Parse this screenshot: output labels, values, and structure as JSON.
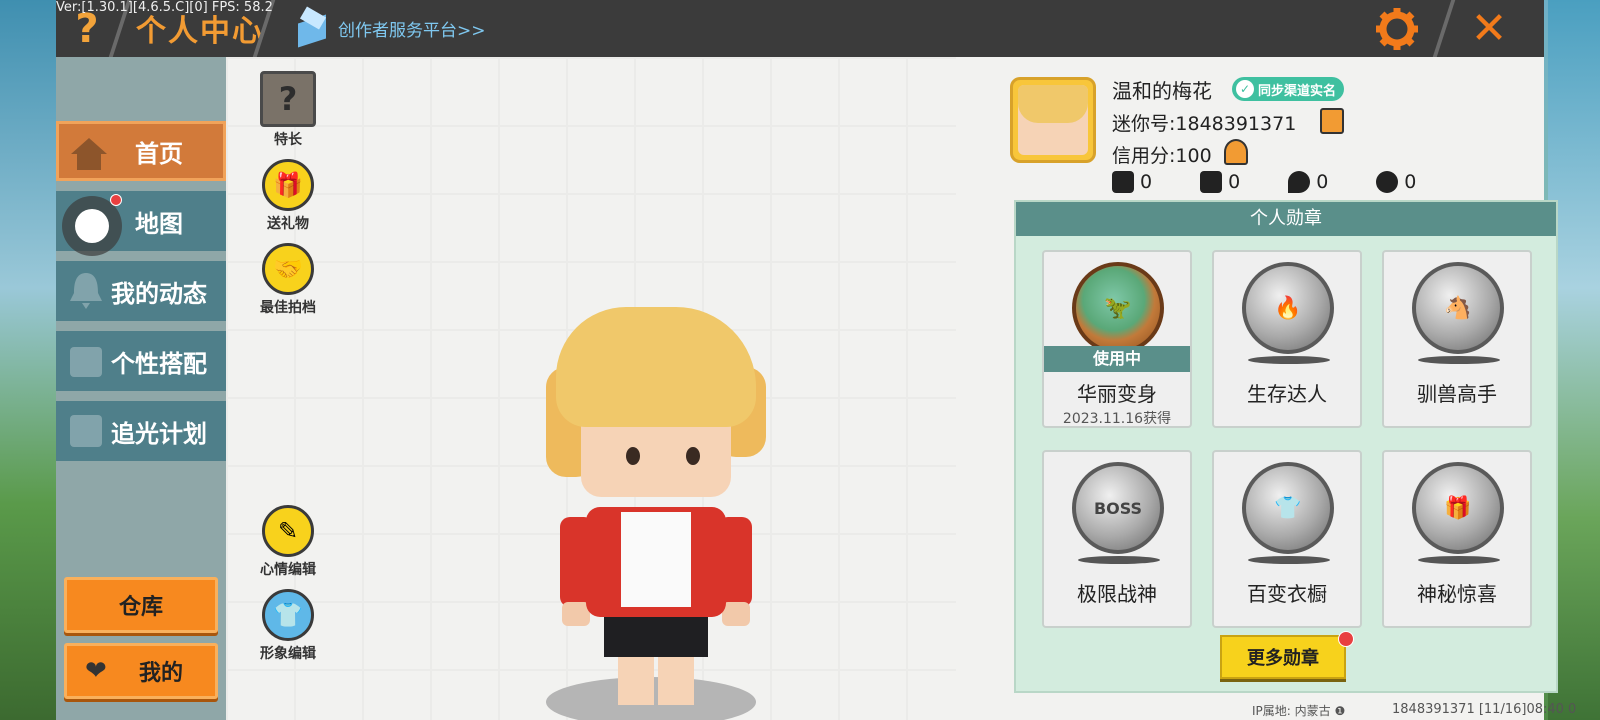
{
  "debug": "Ver:[1.30.1][4.6.5.C][0] FPS: 58.2",
  "header": {
    "help_icon": "?",
    "title": "个人中心",
    "creator_link": "创作者服务平台>>",
    "close_icon": "✕"
  },
  "nav": {
    "items": [
      {
        "label": "首页",
        "icon": "home-icon",
        "active": true
      },
      {
        "label": "地图",
        "icon": "map-icon",
        "active": false
      },
      {
        "label": "我的动态",
        "icon": "bell-icon",
        "active": false
      },
      {
        "label": "个性搭配",
        "icon": "outfit-icon",
        "active": false
      },
      {
        "label": "追光计划",
        "icon": "light-plan-icon",
        "active": false
      }
    ],
    "warehouse_label": "仓库",
    "mine_label": "我的"
  },
  "actions": {
    "specialty": "特长",
    "send_gift": "送礼物",
    "best_partner": "最佳拍档",
    "mood_edit": "心情编辑",
    "image_edit": "形象编辑"
  },
  "profile": {
    "nickname": "温和的梅花",
    "verify_badge": "同步渠道实名",
    "mini_id": "迷你号:1848391371",
    "credit": "信用分:100",
    "stats": [
      {
        "icon": "add-friend-icon",
        "value": "0"
      },
      {
        "icon": "fans-icon",
        "value": "0"
      },
      {
        "icon": "fire-icon",
        "value": "0"
      },
      {
        "icon": "heart-icon",
        "value": "0"
      }
    ]
  },
  "medals": {
    "title": "个人勋章",
    "items": [
      {
        "name": "华丽变身",
        "status": "使用中",
        "date": "2023.11.16获得",
        "glyph": "🦖"
      },
      {
        "name": "生存达人",
        "glyph": "🔥"
      },
      {
        "name": "驯兽高手",
        "glyph": "🐴"
      },
      {
        "name": "极限战神",
        "glyph": "BOSS"
      },
      {
        "name": "百变衣橱",
        "glyph": "👕"
      },
      {
        "name": "神秘惊喜",
        "glyph": "🎁"
      }
    ],
    "more_label": "更多勋章"
  },
  "footer": {
    "ip": "IP属地: 内蒙古 ❶",
    "id_time": "1848391371    [11/16]08:40 0"
  },
  "colors": {
    "accent_orange": "#f29b33",
    "teal": "#5a8f8a",
    "yellow": "#f7d21c"
  }
}
